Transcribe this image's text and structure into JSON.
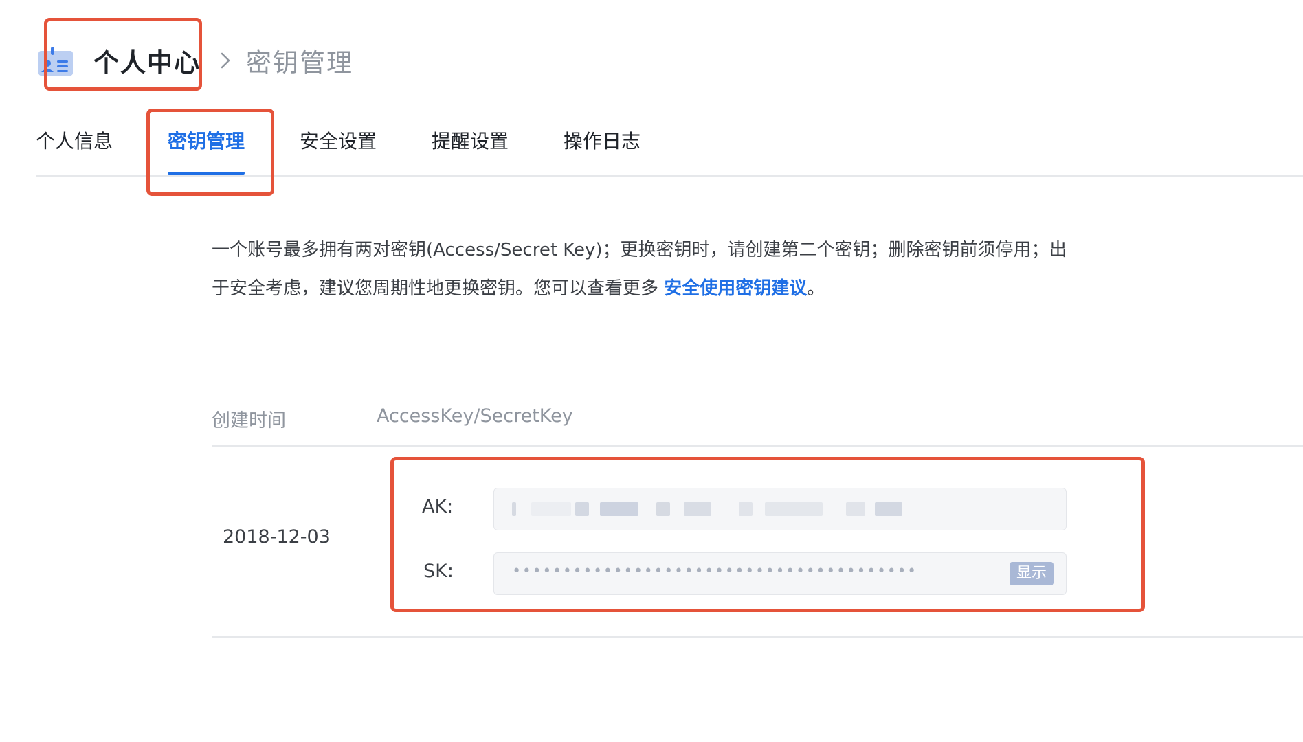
{
  "breadcrumb": {
    "icon": "user-card-icon",
    "root": "个人中心",
    "separator_icon": "chevron-right-icon",
    "current": "密钥管理"
  },
  "tabs": [
    {
      "label": "个人信息",
      "active": false
    },
    {
      "label": "密钥管理",
      "active": true
    },
    {
      "label": "安全设置",
      "active": false
    },
    {
      "label": "提醒设置",
      "active": false
    },
    {
      "label": "操作日志",
      "active": false
    }
  ],
  "description": {
    "text": "一个账号最多拥有两对密钥(Access/Secret Key)；更换密钥时，请创建第二个密钥；删除密钥前须停用；出于安全考虑，建议您周期性地更换密钥。您可以查看更多 ",
    "link": "安全使用密钥建议",
    "suffix": "。"
  },
  "table": {
    "columns": [
      "创建时间",
      "AccessKey/SecretKey"
    ],
    "rows": [
      {
        "created": "2018-12-03",
        "ak_label": "AK:",
        "ak_value_state": "blurred",
        "sk_label": "SK:",
        "sk_value": "••••••••••••••••••••••••••••••••••••••••",
        "sk_show_button": "显示"
      }
    ]
  },
  "colors": {
    "accent": "#1f6fe5",
    "highlight": "#e5533a",
    "muted_text": "#8f959e",
    "divider": "#e6e8eb"
  }
}
